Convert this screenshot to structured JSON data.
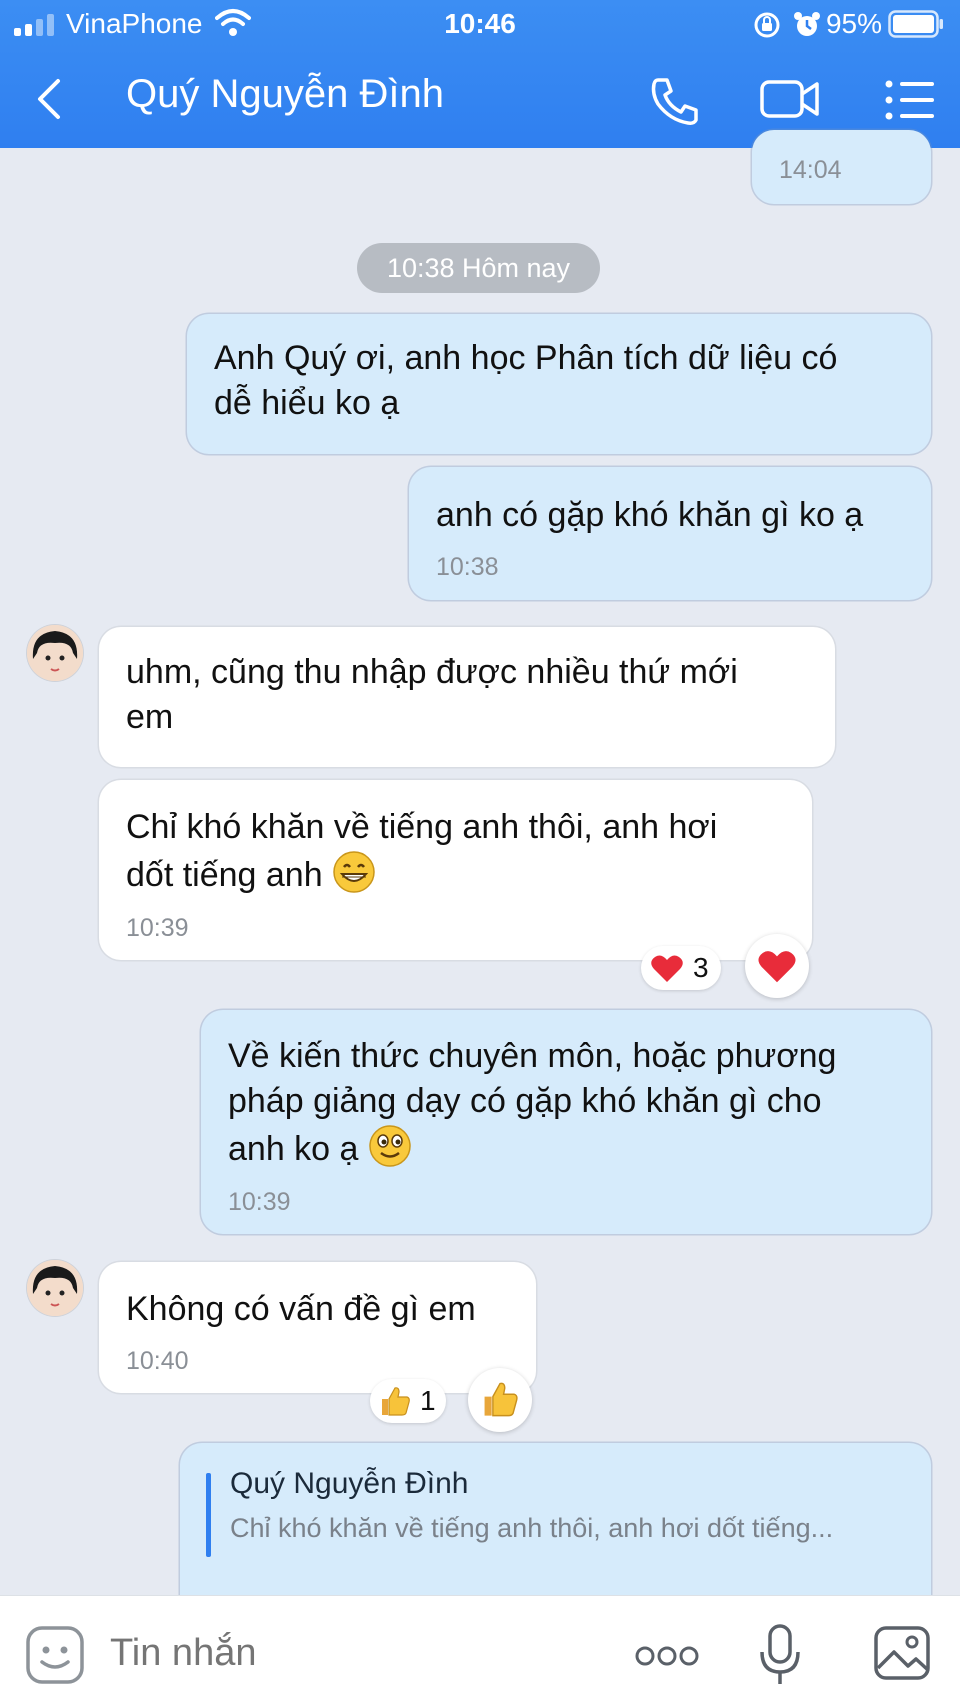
{
  "status_bar": {
    "carrier": "VinaPhone",
    "time": "10:46",
    "battery": "95%"
  },
  "header": {
    "contact_name": "Quý Nguyễn Đình"
  },
  "chat": {
    "prev_time": "14:04",
    "date_divider": "10:38 Hôm nay",
    "messages": [
      {
        "dir": "out",
        "lines": [
          "Anh Quý ơi, anh học Phân tích dữ liệu có",
          "dễ hiểu ko ạ"
        ]
      },
      {
        "dir": "out",
        "lines": [
          "anh có gặp khó khăn gì ko ạ"
        ],
        "time": "10:38"
      },
      {
        "dir": "in",
        "lines": [
          "uhm, cũng thu nhập được nhiều thứ mới",
          "em"
        ]
      },
      {
        "dir": "in",
        "lines": [
          "Chỉ khó khăn về tiếng anh thôi, anh hơi",
          "dốt tiếng anh"
        ],
        "emoji": "grin",
        "time": "10:39",
        "reaction": {
          "icon": "heart",
          "count": "3"
        }
      },
      {
        "dir": "out",
        "lines": [
          "Về kiến thức chuyên môn, hoặc phương",
          "pháp giảng dạy có gặp khó khăn gì cho",
          "anh ko ạ"
        ],
        "emoji": "smile",
        "time": "10:39"
      },
      {
        "dir": "in",
        "lines": [
          "Không có vấn đề gì em"
        ],
        "time": "10:40",
        "reaction": {
          "icon": "thumbs-up",
          "count": "1"
        }
      },
      {
        "dir": "out",
        "quote": {
          "name": "Quý Nguyễn Đình",
          "text": "Chỉ khó khăn về tiếng anh thôi, anh hơi dốt tiếng..."
        }
      }
    ]
  },
  "input_bar": {
    "placeholder": "Tin nhắn"
  },
  "colors": {
    "header": "#2f7ff0",
    "outgoing_bubble": "#d6ebfb",
    "incoming_bubble": "#ffffff",
    "background": "#e6eaf2"
  }
}
